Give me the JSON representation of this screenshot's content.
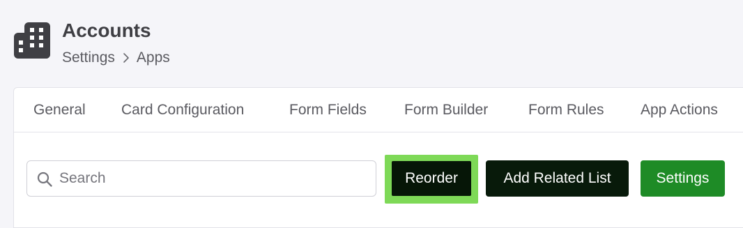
{
  "header": {
    "title": "Accounts",
    "app_icon": "building-icon",
    "breadcrumb": [
      {
        "label": "Settings"
      },
      {
        "label": "Apps"
      }
    ],
    "breadcrumb_separator_icon": "chevron-right-icon"
  },
  "tabs": [
    {
      "label": "General"
    },
    {
      "label": "Card Configuration"
    },
    {
      "label": "Form Fields"
    },
    {
      "label": "Form Builder"
    },
    {
      "label": "Form Rules"
    },
    {
      "label": "App Actions"
    }
  ],
  "toolbar": {
    "search": {
      "placeholder": "Search",
      "value": "",
      "icon": "search-icon"
    },
    "reorder_label": "Reorder",
    "add_related_list_label": "Add Related List",
    "settings_label": "Settings"
  },
  "colors": {
    "background": "#f5f5f9",
    "reorder_highlight": "#7ed957",
    "dark_button": "#081a0a",
    "settings_button": "#1e8b26",
    "icon": "#3f3f44"
  }
}
